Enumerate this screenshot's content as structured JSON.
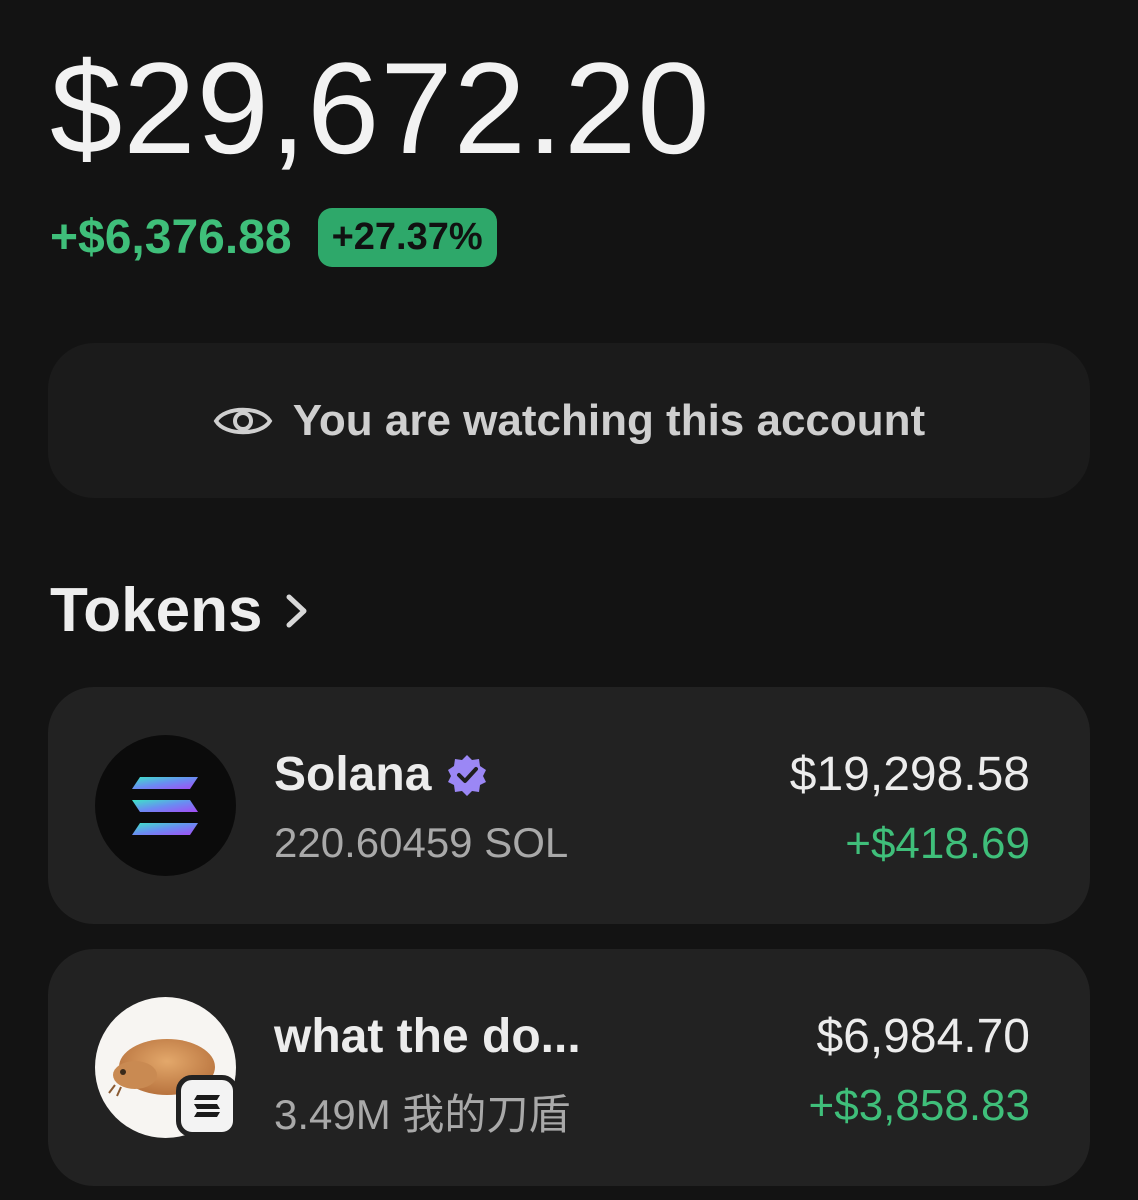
{
  "portfolio": {
    "balance": "$29,672.20",
    "change_amount": "+$6,376.88",
    "change_percent": "+27.37%"
  },
  "watch_banner": {
    "icon": "eye-icon",
    "text": "You are watching this account"
  },
  "tokens_section": {
    "title": "Tokens",
    "icon": "chevron-right-icon"
  },
  "tokens": [
    {
      "name": "Solana",
      "verified": true,
      "quantity": "220.60459 SOL",
      "value": "$19,298.58",
      "pnl": "+$418.69",
      "icon": "solana-logo-icon"
    },
    {
      "name": "what the do...",
      "verified": false,
      "quantity": "3.49M 我的刀盾",
      "value": "$6,984.70",
      "pnl": "+$3,858.83",
      "icon": "dog-meme-token-icon",
      "chain_badge": "solana-chain-badge-icon"
    }
  ],
  "colors": {
    "background": "#131313",
    "card": "#222222",
    "positive": "#3fbf7a",
    "pill": "#2ea86a",
    "verified": "#9b87f5"
  }
}
